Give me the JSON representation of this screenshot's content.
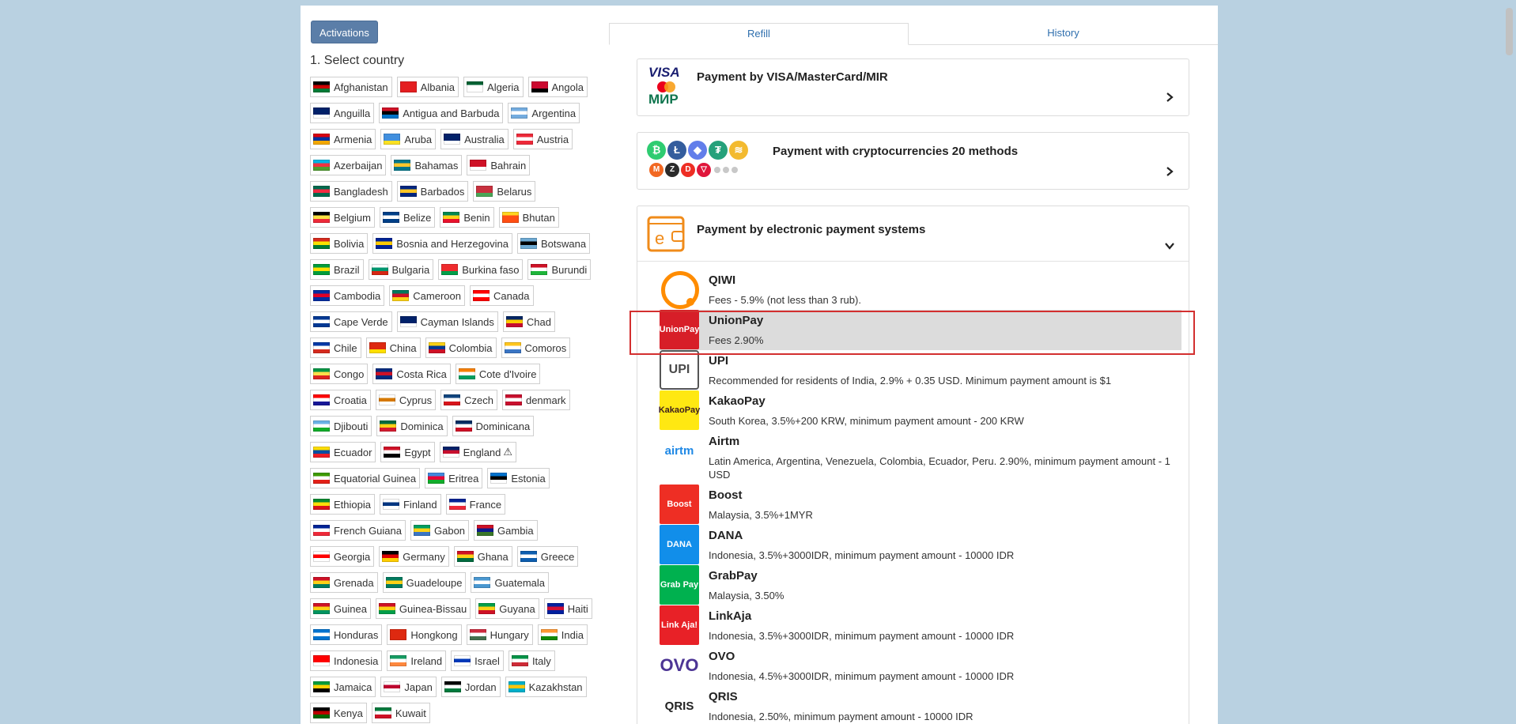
{
  "left": {
    "activations_label": "Activations",
    "select_country_title": "1. Select country",
    "countries": [
      {
        "name": "Afghanistan",
        "flag": [
          "#000000",
          "#cc0000",
          "#007a36"
        ]
      },
      {
        "name": "Albania",
        "flag": [
          "#e41e20",
          "#e41e20",
          "#e41e20"
        ]
      },
      {
        "name": "Algeria",
        "flag": [
          "#006233",
          "#ffffff",
          "#ffffff"
        ]
      },
      {
        "name": "Angola",
        "flag": [
          "#cc092f",
          "#cc092f",
          "#000000"
        ]
      },
      {
        "name": "Anguilla",
        "flag": [
          "#012169",
          "#012169",
          "#ffffff"
        ]
      },
      {
        "name": "Antigua and Barbuda",
        "flag": [
          "#ce1126",
          "#000000",
          "#0072c6"
        ]
      },
      {
        "name": "Argentina",
        "flag": [
          "#74acdf",
          "#ffffff",
          "#74acdf"
        ]
      },
      {
        "name": "Armenia",
        "flag": [
          "#d90012",
          "#0033a0",
          "#f2a800"
        ]
      },
      {
        "name": "Aruba",
        "flag": [
          "#418fde",
          "#418fde",
          "#fbe122"
        ]
      },
      {
        "name": "Australia",
        "flag": [
          "#012169",
          "#012169",
          "#ffffff"
        ]
      },
      {
        "name": "Austria",
        "flag": [
          "#ed2939",
          "#ffffff",
          "#ed2939"
        ]
      },
      {
        "name": "Azerbaijan",
        "flag": [
          "#00b5e2",
          "#ef3340",
          "#509e2f"
        ]
      },
      {
        "name": "Bahamas",
        "flag": [
          "#00778b",
          "#ffc72c",
          "#00778b"
        ]
      },
      {
        "name": "Bahrain",
        "flag": [
          "#ce1126",
          "#ce1126",
          "#ffffff"
        ]
      },
      {
        "name": "Bangladesh",
        "flag": [
          "#006a4e",
          "#f42a41",
          "#006a4e"
        ]
      },
      {
        "name": "Barbados",
        "flag": [
          "#00267f",
          "#ffc726",
          "#00267f"
        ]
      },
      {
        "name": "Belarus",
        "flag": [
          "#c8313e",
          "#c8313e",
          "#4aa657"
        ]
      },
      {
        "name": "Belgium",
        "flag": [
          "#000000",
          "#fae042",
          "#ed2939"
        ]
      },
      {
        "name": "Belize",
        "flag": [
          "#003f87",
          "#ffffff",
          "#003f87"
        ]
      },
      {
        "name": "Benin",
        "flag": [
          "#008751",
          "#fcd116",
          "#e8112d"
        ]
      },
      {
        "name": "Bhutan",
        "flag": [
          "#ffd520",
          "#ff4e12",
          "#ff4e12"
        ]
      },
      {
        "name": "Bolivia",
        "flag": [
          "#d52b1e",
          "#f9e300",
          "#007934"
        ]
      },
      {
        "name": "Bosnia and Herzegovina",
        "flag": [
          "#002395",
          "#fecb00",
          "#002395"
        ]
      },
      {
        "name": "Botswana",
        "flag": [
          "#6da9d2",
          "#000000",
          "#6da9d2"
        ]
      },
      {
        "name": "Brazil",
        "flag": [
          "#009c3b",
          "#ffdf00",
          "#009c3b"
        ]
      },
      {
        "name": "Bulgaria",
        "flag": [
          "#ffffff",
          "#00966e",
          "#d62612"
        ]
      },
      {
        "name": "Burkina faso",
        "flag": [
          "#ef2b2d",
          "#ef2b2d",
          "#009e49"
        ]
      },
      {
        "name": "Burundi",
        "flag": [
          "#ce1126",
          "#ffffff",
          "#1eb53a"
        ]
      },
      {
        "name": "Cambodia",
        "flag": [
          "#032ea1",
          "#e00025",
          "#032ea1"
        ]
      },
      {
        "name": "Cameroon",
        "flag": [
          "#007a5e",
          "#ce1126",
          "#fcd116"
        ]
      },
      {
        "name": "Canada",
        "flag": [
          "#ff0000",
          "#ffffff",
          "#ff0000"
        ]
      },
      {
        "name": "Cape Verde",
        "flag": [
          "#003893",
          "#ffffff",
          "#003893"
        ]
      },
      {
        "name": "Cayman Islands",
        "flag": [
          "#012169",
          "#012169",
          "#ffffff"
        ]
      },
      {
        "name": "Chad",
        "flag": [
          "#002664",
          "#fecb00",
          "#c60c30"
        ]
      },
      {
        "name": "Chile",
        "flag": [
          "#0039a6",
          "#ffffff",
          "#d52b1e"
        ]
      },
      {
        "name": "China",
        "flag": [
          "#de2910",
          "#de2910",
          "#ffde00"
        ]
      },
      {
        "name": "Colombia",
        "flag": [
          "#fcd116",
          "#003893",
          "#ce1126"
        ]
      },
      {
        "name": "Comoros",
        "flag": [
          "#ffc61e",
          "#ffffff",
          "#3a75c4"
        ]
      },
      {
        "name": "Congo",
        "flag": [
          "#009543",
          "#fbde4a",
          "#dc241f"
        ]
      },
      {
        "name": "Costa Rica",
        "flag": [
          "#002b7f",
          "#ce1126",
          "#002b7f"
        ]
      },
      {
        "name": "Cote d'Ivoire",
        "flag": [
          "#f77f00",
          "#ffffff",
          "#009e60"
        ]
      },
      {
        "name": "Croatia",
        "flag": [
          "#ff0000",
          "#ffffff",
          "#171796"
        ]
      },
      {
        "name": "Cyprus",
        "flag": [
          "#ffffff",
          "#d57800",
          "#ffffff"
        ]
      },
      {
        "name": "Czech",
        "flag": [
          "#11457e",
          "#ffffff",
          "#d7141a"
        ]
      },
      {
        "name": "denmark",
        "flag": [
          "#c8102e",
          "#ffffff",
          "#c8102e"
        ]
      },
      {
        "name": "Djibouti",
        "flag": [
          "#6ab2e7",
          "#ffffff",
          "#12ad2b"
        ]
      },
      {
        "name": "Dominica",
        "flag": [
          "#006b3f",
          "#fcd116",
          "#d41c30"
        ]
      },
      {
        "name": "Dominicana",
        "flag": [
          "#002d62",
          "#ffffff",
          "#ce1126"
        ]
      },
      {
        "name": "Ecuador",
        "flag": [
          "#ffdd00",
          "#034ea2",
          "#ed1c24"
        ]
      },
      {
        "name": "Egypt",
        "flag": [
          "#ce1126",
          "#ffffff",
          "#000000"
        ]
      },
      {
        "name": "England",
        "flag": [
          "#012169",
          "#c8102e",
          "#ffffff"
        ]
      },
      {
        "name": "Equatorial Guinea",
        "flag": [
          "#3e9a00",
          "#ffffff",
          "#e32118"
        ]
      },
      {
        "name": "Eritrea",
        "flag": [
          "#4189dd",
          "#ea0437",
          "#12ad2b"
        ]
      },
      {
        "name": "Estonia",
        "flag": [
          "#0072ce",
          "#000000",
          "#ffffff"
        ]
      },
      {
        "name": "Ethiopia",
        "flag": [
          "#078930",
          "#fcdd09",
          "#da121a"
        ]
      },
      {
        "name": "Finland",
        "flag": [
          "#ffffff",
          "#003580",
          "#ffffff"
        ]
      },
      {
        "name": "France",
        "flag": [
          "#002395",
          "#ffffff",
          "#ed2939"
        ]
      },
      {
        "name": "French Guiana",
        "flag": [
          "#002395",
          "#ffffff",
          "#ed2939"
        ]
      },
      {
        "name": "Gabon",
        "flag": [
          "#009e60",
          "#fcd116",
          "#3a75c4"
        ]
      },
      {
        "name": "Gambia",
        "flag": [
          "#ce1126",
          "#0c1c8c",
          "#3a7728"
        ]
      },
      {
        "name": "Georgia",
        "flag": [
          "#ffffff",
          "#ff0000",
          "#ffffff"
        ]
      },
      {
        "name": "Germany",
        "flag": [
          "#000000",
          "#dd0000",
          "#ffce00"
        ]
      },
      {
        "name": "Ghana",
        "flag": [
          "#ce1126",
          "#fcd116",
          "#006b3f"
        ]
      },
      {
        "name": "Greece",
        "flag": [
          "#0d5eaf",
          "#ffffff",
          "#0d5eaf"
        ]
      },
      {
        "name": "Grenada",
        "flag": [
          "#ce1126",
          "#fcd116",
          "#007a5e"
        ]
      },
      {
        "name": "Guadeloupe",
        "flag": [
          "#007a5e",
          "#fcd116",
          "#007a5e"
        ]
      },
      {
        "name": "Guatemala",
        "flag": [
          "#4997d0",
          "#ffffff",
          "#4997d0"
        ]
      },
      {
        "name": "Guinea",
        "flag": [
          "#ce1126",
          "#fcd116",
          "#009460"
        ]
      },
      {
        "name": "Guinea-Bissau",
        "flag": [
          "#ce1126",
          "#fcd116",
          "#009e49"
        ]
      },
      {
        "name": "Guyana",
        "flag": [
          "#009e49",
          "#fcd116",
          "#ce1126"
        ]
      },
      {
        "name": "Haiti",
        "flag": [
          "#00209f",
          "#d21034",
          "#00209f"
        ]
      },
      {
        "name": "Honduras",
        "flag": [
          "#0073cf",
          "#ffffff",
          "#0073cf"
        ]
      },
      {
        "name": "Hongkong",
        "flag": [
          "#de2910",
          "#de2910",
          "#de2910"
        ]
      },
      {
        "name": "Hungary",
        "flag": [
          "#cd2a3e",
          "#ffffff",
          "#436f4d"
        ]
      },
      {
        "name": "India",
        "flag": [
          "#ff9933",
          "#ffffff",
          "#138808"
        ]
      },
      {
        "name": "Indonesia",
        "flag": [
          "#ff0000",
          "#ff0000",
          "#ffffff"
        ]
      },
      {
        "name": "Ireland",
        "flag": [
          "#169b62",
          "#ffffff",
          "#ff883e"
        ]
      },
      {
        "name": "Israel",
        "flag": [
          "#ffffff",
          "#0038b8",
          "#ffffff"
        ]
      },
      {
        "name": "Italy",
        "flag": [
          "#009246",
          "#ffffff",
          "#ce2b37"
        ]
      },
      {
        "name": "Jamaica",
        "flag": [
          "#009b3a",
          "#fed100",
          "#000000"
        ]
      },
      {
        "name": "Japan",
        "flag": [
          "#ffffff",
          "#bc002d",
          "#ffffff"
        ]
      },
      {
        "name": "Jordan",
        "flag": [
          "#000000",
          "#ffffff",
          "#007a3d"
        ]
      },
      {
        "name": "Kazakhstan",
        "flag": [
          "#00afca",
          "#fec50c",
          "#00afca"
        ]
      },
      {
        "name": "Kenya",
        "flag": [
          "#000000",
          "#bb0000",
          "#006600"
        ]
      },
      {
        "name": "Kuwait",
        "flag": [
          "#007a3d",
          "#ffffff",
          "#ce1126"
        ]
      }
    ]
  },
  "right": {
    "tabs": {
      "refill": "Refill",
      "history": "History"
    },
    "card_visa": {
      "title": "Payment by VISA/MasterCard/MIR",
      "logo_text_top": "VISA",
      "logo_text_bottom": "МИР"
    },
    "card_crypto": {
      "title": "Payment with cryptocurrencies 20 methods"
    },
    "card_eps": {
      "title": "Payment by electronic payment systems"
    },
    "methods": [
      {
        "name": "QIWI",
        "desc": "Fees - 5.9% (not less than 3 rub).",
        "logo_text": "",
        "logo_color": "#ff8c00"
      },
      {
        "name": "UnionPay",
        "desc": "Fees 2.90%",
        "logo_text": "UnionPay",
        "logo_color": "#d71e28"
      },
      {
        "name": "UPI",
        "desc": "Recommended for residents of India, 2.9% + 0.35 USD. Minimum payment amount is $1",
        "logo_text": "UPI",
        "logo_color": "#4a4a4a"
      },
      {
        "name": "KakaoPay",
        "desc": "South Korea, 3.5%+200 KRW, minimum payment amount - 200 KRW",
        "logo_text": "KakaoPay",
        "logo_color": "#ffe812"
      },
      {
        "name": "Airtm",
        "desc": "Latin America, Argentina, Venezuela, Colombia, Ecuador, Peru. 2.90%, minimum payment amount - 1 USD",
        "logo_text": "airtm",
        "logo_color": "#1e88e5"
      },
      {
        "name": "Boost",
        "desc": "Malaysia, 3.5%+1MYR",
        "logo_text": "Boost",
        "logo_color": "#ee2e24"
      },
      {
        "name": "DANA",
        "desc": "Indonesia, 3.5%+3000IDR, minimum payment amount - 10000 IDR",
        "logo_text": "DANA",
        "logo_color": "#118eea"
      },
      {
        "name": "GrabPay",
        "desc": "Malaysia, 3.50%",
        "logo_text": "Grab Pay",
        "logo_color": "#00b14f"
      },
      {
        "name": "LinkAja",
        "desc": "Indonesia, 3.5%+3000IDR, minimum payment amount - 10000 IDR",
        "logo_text": "Link Aja!",
        "logo_color": "#e82127"
      },
      {
        "name": "OVO",
        "desc": "Indonesia, 4.5%+3000IDR, minimum payment amount - 10000 IDR",
        "logo_text": "OVO",
        "logo_color": "#4c3494"
      },
      {
        "name": "QRIS",
        "desc": "Indonesia, 2.50%, minimum payment amount - 10000 IDR",
        "logo_text": "QRIS",
        "logo_color": "#222222"
      }
    ]
  }
}
